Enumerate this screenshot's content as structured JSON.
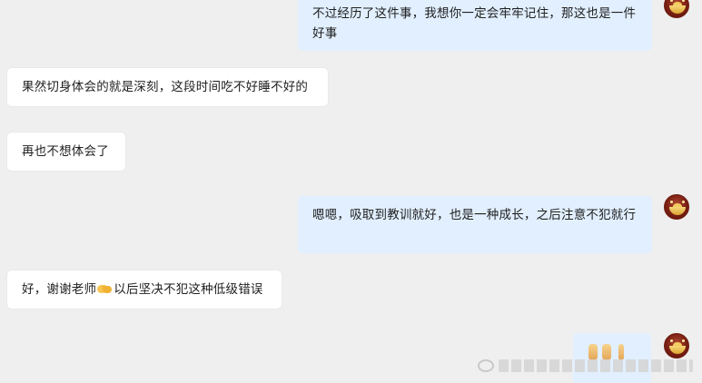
{
  "messages": [
    {
      "side": "right",
      "text": "不过经历了这件事，我想你一定会牢牢记住，那这也是一件好事"
    },
    {
      "side": "left",
      "text": "果然切身体会的就是深刻，这段时间吃不好睡不好的"
    },
    {
      "side": "left",
      "text": "再也不想体会了"
    },
    {
      "side": "right",
      "text": "嗯嗯，吸取到教训就好，也是一种成长，之后注意不犯就行"
    },
    {
      "side": "left",
      "text_before": "好，谢谢老师",
      "text_after": "以后坚决不犯这种低级错误",
      "emoji_icon": "handshake-emoji"
    },
    {
      "side": "right",
      "type": "sticker"
    }
  ],
  "colors": {
    "background": "#efefef",
    "left_bubble": "#ffffff",
    "right_bubble": "#e1efff"
  }
}
